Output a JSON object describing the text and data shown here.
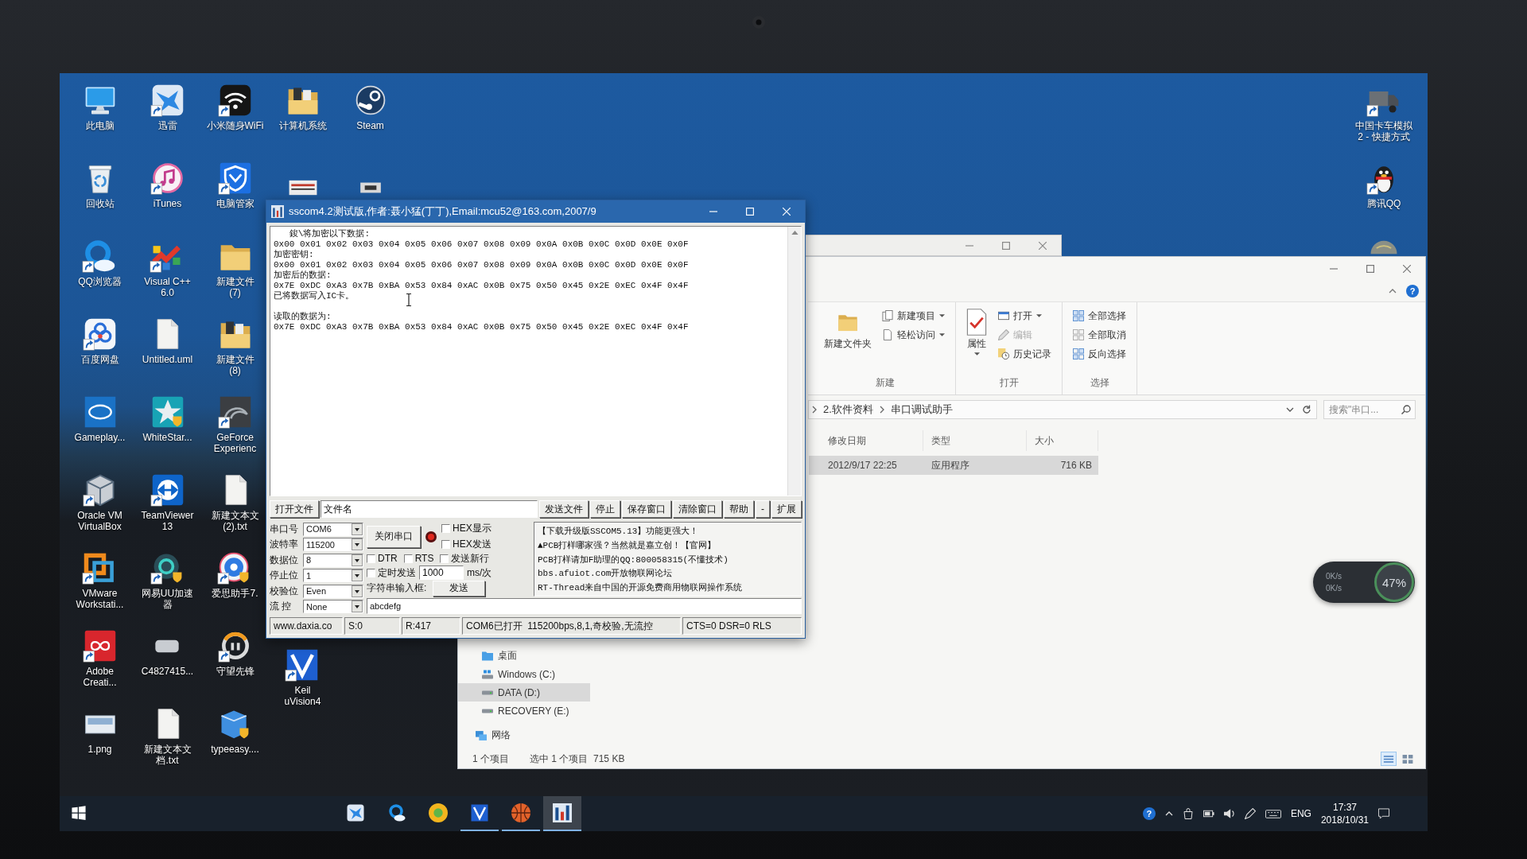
{
  "bezel": {
    "webcam": true
  },
  "desktop": {
    "icon_columns": [
      [
        {
          "kind": "computer",
          "label": "此电脑",
          "shortcut": false
        },
        {
          "kind": "recycle-bin",
          "label": "回收站",
          "shortcut": false
        },
        {
          "kind": "cloud-ring",
          "label": "QQ浏览器",
          "shortcut": true
        },
        {
          "kind": "rings",
          "label": "百度网盘",
          "shortcut": true
        },
        {
          "kind": "oval-tile",
          "label": "Gameplay...",
          "shortcut": false
        },
        {
          "kind": "cube",
          "label": "Oracle VM\nVirtualBox",
          "shortcut": true
        },
        {
          "kind": "squares",
          "label": "VMware\nWorkstati...",
          "shortcut": true
        },
        {
          "kind": "loop-tile",
          "label": "Adobe\nCreati...",
          "shortcut": true
        },
        {
          "kind": "image",
          "label": "1.png",
          "shortcut": false
        }
      ],
      [
        {
          "kind": "bird",
          "label": "迅雷",
          "shortcut": true
        },
        {
          "kind": "music",
          "label": "iTunes",
          "shortcut": true
        },
        {
          "kind": "arrows",
          "label": "Visual C++\n6.0",
          "shortcut": true
        },
        {
          "kind": "document",
          "label": "Untitled.uml",
          "shortcut": false
        },
        {
          "kind": "star",
          "label": "WhiteStar...",
          "shortcut": false
        },
        {
          "kind": "double-arrow",
          "label": "TeamViewer\n13",
          "shortcut": true
        },
        {
          "kind": "ring-shield",
          "label": "网易UU加速器",
          "shortcut": true
        },
        {
          "kind": "blur",
          "label": "C4827415...",
          "shortcut": false
        },
        {
          "kind": "document",
          "label": "新建文本文档.txt",
          "shortcut": false
        }
      ],
      [
        {
          "kind": "wifi",
          "label": "小米随身WiFi",
          "shortcut": true
        },
        {
          "kind": "shield",
          "label": "电脑管家",
          "shortcut": true
        },
        {
          "kind": "folder",
          "label": "新建文件\n(7)",
          "shortcut": false
        },
        {
          "kind": "folder-files",
          "label": "新建文件\n(8)",
          "shortcut": false
        },
        {
          "kind": "swirl",
          "label": "GeForce\nExperienc",
          "shortcut": true
        },
        {
          "kind": "document",
          "label": "新建文本文\n(2).txt",
          "shortcut": false
        },
        {
          "kind": "ball-shield",
          "label": "爱思助手7.",
          "shortcut": true
        },
        {
          "kind": "emblem",
          "label": "守望先锋",
          "shortcut": true
        },
        {
          "kind": "box-shield",
          "label": "typeeasy....",
          "shortcut": false
        }
      ],
      [
        {
          "kind": "folder-files",
          "label": "计算机系统",
          "shortcut": false
        },
        {
          "kind": "card-top"
        }
      ],
      [
        {
          "kind": "steam",
          "label": "Steam",
          "shortcut": false
        },
        {
          "kind": "device-top"
        }
      ]
    ],
    "below_window": [
      {
        "kind": "v-tile",
        "label": "Keil\nuVision4",
        "shortcut": true
      }
    ],
    "right_column": [
      {
        "kind": "truck",
        "label": "中国卡车模拟\n2 - 快捷方式",
        "shortcut": true
      },
      {
        "kind": "penguin",
        "label": "腾讯QQ",
        "shortcut": true
      },
      {
        "kind": "globe-top"
      }
    ]
  },
  "background_window": {
    "window_buttons": [
      {
        "kind": "minimize"
      },
      {
        "kind": "maximize"
      },
      {
        "kind": "close"
      }
    ]
  },
  "file_explorer": {
    "window_buttons": [
      {
        "kind": "minimize"
      },
      {
        "kind": "maximize"
      },
      {
        "kind": "close"
      }
    ],
    "help_glyph": "?",
    "ribbon_groups": [
      {
        "label": "新建",
        "items": [
          {
            "kind": "new-folder",
            "label": "新建文件夹",
            "dropdown": false,
            "disabled": false
          },
          {
            "kind": "new-item",
            "label": "新建项目",
            "dropdown": true,
            "disabled": false
          },
          {
            "kind": "easy-access",
            "label": "轻松访问",
            "dropdown": true,
            "disabled": false
          }
        ]
      },
      {
        "label": "打开",
        "items": [
          {
            "kind": "properties",
            "label": "属性",
            "dropdown": true,
            "disabled": false
          },
          {
            "kind": "open",
            "label": "打开",
            "dropdown": true,
            "disabled": false
          },
          {
            "kind": "edit",
            "label": "编辑",
            "dropdown": false,
            "disabled": true
          },
          {
            "kind": "history",
            "label": "历史记录",
            "dropdown": false,
            "disabled": false
          }
        ]
      },
      {
        "label": "选择",
        "items": [
          {
            "kind": "select-all",
            "label": "全部选择",
            "dropdown": false,
            "disabled": false
          },
          {
            "kind": "select-none",
            "label": "全部取消",
            "dropdown": false,
            "disabled": false
          },
          {
            "kind": "invert",
            "label": "反向选择",
            "dropdown": false,
            "disabled": false
          }
        ]
      }
    ],
    "breadcrumb": [
      "2.软件资料",
      "串口调试助手"
    ],
    "search_placeholder": "搜索\"串口...",
    "columns": [
      "修改日期",
      "类型",
      "大小"
    ],
    "rows": [
      {
        "cells": [
          "2012/9/17 22:25",
          "应用程序",
          "716 KB"
        ],
        "selected": true
      }
    ],
    "nav_items": [
      {
        "kind": "desktop",
        "label": "桌面",
        "selected": false
      },
      {
        "kind": "drive-system",
        "label": "Windows (C:)",
        "selected": false
      },
      {
        "kind": "drive",
        "label": "DATA (D:)",
        "selected": true
      },
      {
        "kind": "drive",
        "label": "RECOVERY (E:)",
        "selected": false
      },
      {
        "kind": "network",
        "label": "网络",
        "selected": false
      }
    ],
    "status": [
      "1 个项目",
      "选中 1 个项目  715 KB"
    ],
    "view_buttons": [
      {
        "kind": "details",
        "selected": true
      },
      {
        "kind": "tiles",
        "selected": false
      }
    ]
  },
  "serial_tool": {
    "title": "sscom4.2测试版,作者:聂小猛(丁丁),Email:mcu52@163.com,2007/9",
    "window_buttons": [
      {
        "kind": "minimize"
      },
      {
        "kind": "maximize"
      },
      {
        "kind": "close"
      }
    ],
    "receive_blocks": [
      [
        "   鋑\\将加密以下数据:",
        "0x00 0x01 0x02 0x03 0x04 0x05 0x06 0x07 0x08 0x09 0x0A 0x0B 0x0C 0x0D 0x0E 0x0F",
        "加密密钥:",
        "0x00 0x01 0x02 0x03 0x04 0x05 0x06 0x07 0x08 0x09 0x0A 0x0B 0x0C 0x0D 0x0E 0x0F",
        "加密后的数据:",
        "0x7E 0xDC 0xA3 0x7B 0xBA 0x53 0x84 0xAC 0x0B 0x75 0x50 0x45 0x2E 0xEC 0x4F 0x4F",
        "已将数据写入IC卡。"
      ],
      [
        "读取的数据为:",
        "0x7E 0xDC 0xA3 0x7B 0xBA 0x53 0x84 0xAC 0x0B 0x75 0x50 0x45 0x2E 0xEC 0x4F 0x4F"
      ]
    ],
    "mouse_pointer": {
      "kind": "i-beam"
    },
    "open_file_button": "打开文件",
    "file_name": "文件名",
    "toolbar_buttons": [
      "发送文件",
      "停止",
      "保存窗口",
      "清除窗口",
      "帮助",
      "-",
      "扩展"
    ],
    "port_settings": [
      {
        "label": "串口号",
        "value": "COM6"
      },
      {
        "label": "波特率",
        "value": "115200"
      },
      {
        "label": "数据位",
        "value": "8"
      },
      {
        "label": "停止位",
        "value": "1"
      },
      {
        "label": "校验位",
        "value": "Even"
      },
      {
        "label": "流 控",
        "value": "None"
      }
    ],
    "port_button": "关闭串口",
    "port_open": true,
    "hex_options": [
      {
        "label": "HEX显示",
        "checked": false
      },
      {
        "label": "HEX发送",
        "checked": false
      }
    ],
    "line_options": [
      {
        "label": "DTR",
        "checked": false
      },
      {
        "label": "RTS",
        "checked": false
      },
      {
        "label": "发送新行",
        "checked": false
      }
    ],
    "timer": {
      "label": "定时发送",
      "checked": false,
      "interval": "1000",
      "unit": "ms/次"
    },
    "input_label": "字符串输入框:",
    "send_button": "发送",
    "input_value": "abcdefg",
    "ad_lines": [
      "【下载升级版SSCOM5.13】功能更强大！",
      "▲PCB打样哪家强？当然就是嘉立创！【官网】",
      "PCB打样请加F助理的QQ:800058315(不懂技术)",
      "bbs.afuiot.com开放物联网论坛",
      "RT-Thread来自中国的开源免费商用物联网操作系统"
    ],
    "status": [
      "www.daxia.co",
      "S:0",
      "R:417",
      "COM6已打开  115200bps,8,1,奇校验,无流控",
      "CTS=0 DSR=0 RLS"
    ]
  },
  "speed_widget": {
    "lines": [
      "0K/s",
      "0K/s"
    ],
    "percent": "47%"
  },
  "taskbar": {
    "apps": [
      {
        "kind": "windows-logo",
        "running": false,
        "selected": false
      },
      {
        "kind": "bird",
        "running": false,
        "selected": false
      },
      {
        "kind": "cloud-ring",
        "running": false,
        "selected": false
      },
      {
        "kind": "ball",
        "running": false,
        "selected": false
      },
      {
        "kind": "v-tile",
        "running": true,
        "selected": false
      },
      {
        "kind": "basketball",
        "running": true,
        "selected": false
      },
      {
        "kind": "serial-app",
        "running": true,
        "selected": true
      }
    ],
    "tray_icons": [
      {
        "kind": "help",
        "glyph": "?"
      },
      {
        "kind": "chevron-up"
      },
      {
        "kind": "bag"
      },
      {
        "kind": "battery"
      },
      {
        "kind": "volume"
      },
      {
        "kind": "pen"
      },
      {
        "kind": "keyboard"
      }
    ],
    "language": "ENG",
    "time": "17:37",
    "date": "2018/10/31",
    "notification": {
      "kind": "action-center"
    }
  }
}
